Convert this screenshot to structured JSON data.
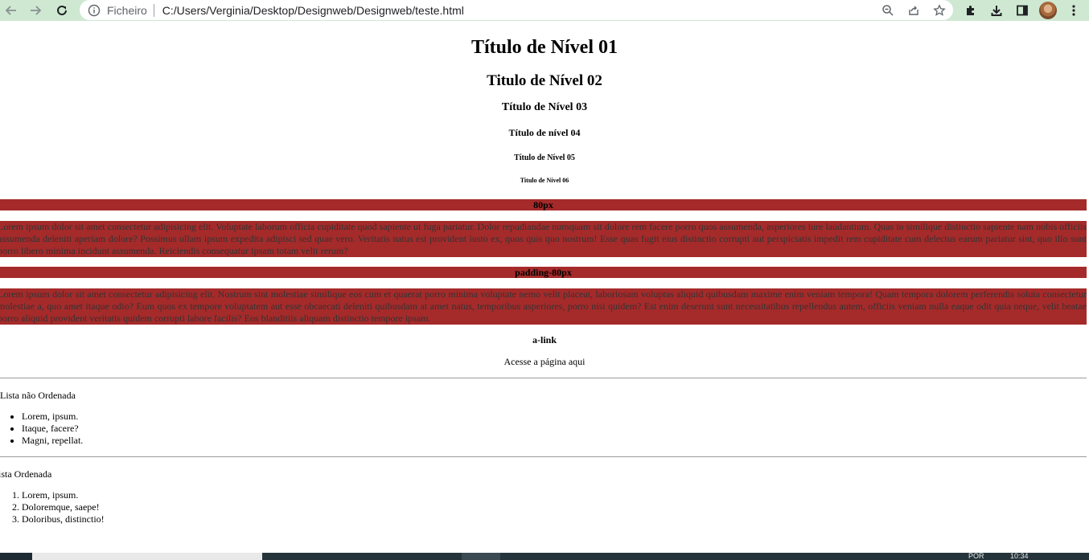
{
  "browser": {
    "scheme_label": "Ficheiro",
    "url": "C:/Users/Verginia/Desktop/Designweb/Designweb/teste.html",
    "accent_toolbar": "#cfe8d2"
  },
  "headings": {
    "h1": "Título de Nível 01",
    "h2": "Titulo de Nível 02",
    "h3": "Título de Nível 03",
    "h4": "Título de nível 04",
    "h5": "Título de Nível 05",
    "h6": "Titulo de Nível 06"
  },
  "sections": {
    "bar1_label": "80px",
    "para1": "Lorem ipsum dolor sit amet consectetur adipisicing elit. Voluptate laborum officia cupiditate quod sapiente ut fuga pariatur. Dolor repudiandae numquam sit dolore rem facere porro quos assumenda, asperiores iure laudantium. Quas in similique distinctio sapiente nam nobis officiis assumenda deleniti aperiam dolore? Possimus ullam ipsum expedita adipisci sed quae vero. Veritatis natus est provident iusto ex, quos quis quo nostrum! Esse quas fugit eius distinctio corrupti aut perspiciatis impedit rem cupiditate cum delectus earum pariatur sint, quo illo sunt porro libero minima incidunt assumenda. Reiciendis consequatur ipsam totam velit rerum?",
    "bar2_label": "padding-80px",
    "para2": "Lorem ipsum dolor sit amet consectetur adipisicing elit. Nostrum sint molestiae similique eos cum et quaerat porro minima voluptate nemo velit placeat, laboriosam voluptas aliquid quibusdam maxime enim veniam tempora! Quam tempora dolorem perferendis soluta consectetur molestiae a, quo amet itaque odio? Eum quos ex tempore voluptatem aut esse obcaecati deleniti quibusdam at amet natus, temporibus asperiores, porro nisi quidem? Est enim deserunt sunt necessitatibus repellendus autem, officiis veniam nulla eaque odit quia neque, velit beatae porro aliquid provident veritatis quidem corrupti labore facilis? Eos blanditiis aliquam distinctio tempore ipsam.",
    "bar_color": "#a52a2a"
  },
  "alink": {
    "title": "a-link",
    "text": "Acesse a página aqui"
  },
  "unordered": {
    "title": "Lista não Ordenada",
    "items": [
      "Lorem, ipsum.",
      "Itaque, facere?",
      "Magni, repellat."
    ]
  },
  "ordered": {
    "title": "ista Ordenada",
    "items": [
      "Lorem, ipsum.",
      "Doloremque, saepe!",
      "Doloribus, distinctio!"
    ]
  },
  "taskbar": {
    "lang": "POR",
    "time": "10:34"
  }
}
